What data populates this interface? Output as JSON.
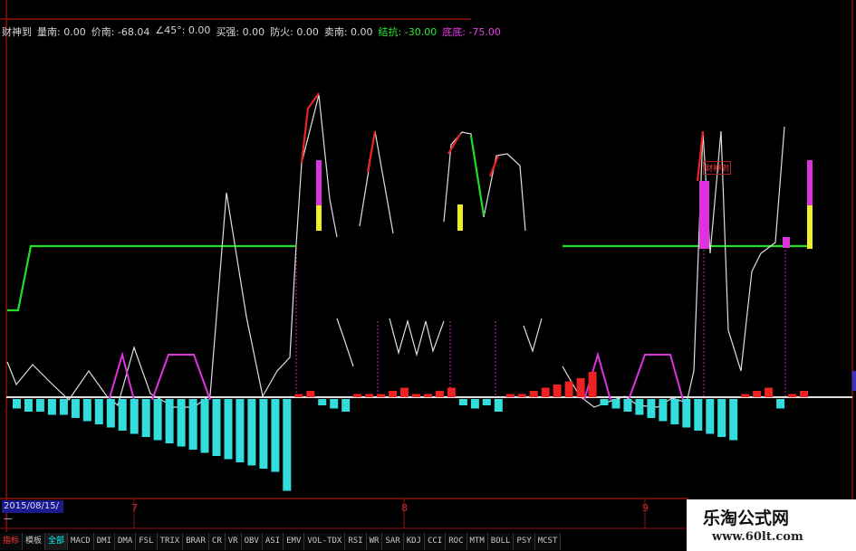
{
  "header": {
    "indicator_name": "财神到",
    "fields": [
      {
        "label": "量南: 0.00",
        "color": "normal"
      },
      {
        "label": "价南: -68.04",
        "color": "normal"
      },
      {
        "label": "∠45°: 0.00",
        "color": "normal"
      },
      {
        "label": "买强: 0.00",
        "color": "normal"
      },
      {
        "label": "防火: 0.00",
        "color": "normal"
      },
      {
        "label": "卖南: 0.00",
        "color": "normal"
      },
      {
        "label": "结抗: -30.00",
        "color": "green"
      },
      {
        "label": "底底: -75.00",
        "color": "magenta"
      }
    ]
  },
  "chart_badge": "财神到",
  "x_axis": {
    "date_box": "2015/08/15/—",
    "month_ticks": [
      "7",
      "8",
      "9"
    ]
  },
  "bottom_tabs": [
    {
      "label": "指标",
      "state": "first"
    },
    {
      "label": "模板",
      "state": "normal"
    },
    {
      "label": "全部",
      "state": "active"
    },
    {
      "label": "MACD",
      "state": "normal"
    },
    {
      "label": "DMI",
      "state": "normal"
    },
    {
      "label": "DMA",
      "state": "normal"
    },
    {
      "label": "FSL",
      "state": "normal"
    },
    {
      "label": "TRIX",
      "state": "normal"
    },
    {
      "label": "BRAR",
      "state": "normal"
    },
    {
      "label": "CR",
      "state": "normal"
    },
    {
      "label": "VR",
      "state": "normal"
    },
    {
      "label": "OBV",
      "state": "normal"
    },
    {
      "label": "ASI",
      "state": "normal"
    },
    {
      "label": "EMV",
      "state": "normal"
    },
    {
      "label": "VOL-TDX",
      "state": "normal"
    },
    {
      "label": "RSI",
      "state": "normal"
    },
    {
      "label": "WR",
      "state": "normal"
    },
    {
      "label": "SAR",
      "state": "normal"
    },
    {
      "label": "KDJ",
      "state": "normal"
    },
    {
      "label": "CCI",
      "state": "normal"
    },
    {
      "label": "ROC",
      "state": "normal"
    },
    {
      "label": "MTM",
      "state": "normal"
    },
    {
      "label": "BOLL",
      "state": "normal"
    },
    {
      "label": "PSY",
      "state": "normal"
    },
    {
      "label": "MCST",
      "state": "normal"
    }
  ],
  "watermark": {
    "line1": "乐淘公式网",
    "line2": "www.60lt.com"
  },
  "colors": {
    "background": "#000000",
    "frame_red": "#8b1010",
    "baseline_green": "#22dd22",
    "white_line": "#e0e0e0",
    "bar_cyan": "#33dddd",
    "bar_red": "#ee2222",
    "magenta": "#dd33dd",
    "yellow": "#eeee22"
  },
  "chart_data": {
    "type": "bar",
    "title": "",
    "xlabel": "",
    "ylabel": "",
    "series": [
      {
        "values": [
          -3,
          -4,
          -4,
          -5,
          -5,
          -6,
          -7,
          -8,
          -9,
          -10,
          -11,
          -12,
          -13,
          -14,
          -15,
          -16,
          -17,
          -18,
          -19,
          -20,
          -21,
          -22,
          -23,
          -29,
          1,
          2,
          -2,
          -3,
          -4,
          1,
          1,
          1,
          2,
          3,
          1,
          1,
          2,
          3,
          -2,
          -3,
          -2,
          -4,
          1,
          1,
          2,
          3,
          4,
          5,
          6,
          8,
          -2,
          -3,
          -4,
          -5,
          -6,
          -7,
          -8,
          -9,
          -10,
          -11,
          -12,
          -13,
          1,
          2,
          3,
          -3,
          1,
          2
        ]
      }
    ]
  }
}
